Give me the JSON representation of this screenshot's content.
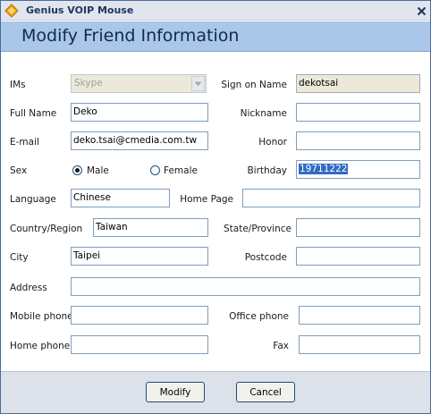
{
  "window": {
    "app_title": "Genius VOIP Mouse",
    "dialog_title": "Modify Friend Information"
  },
  "form": {
    "ims": {
      "label": "IMs",
      "value": "Skype"
    },
    "sign_on_name": {
      "label": "Sign on Name",
      "value": "dekotsai"
    },
    "full_name": {
      "label": "Full Name",
      "value": "Deko"
    },
    "nickname": {
      "label": "Nickname",
      "value": ""
    },
    "email": {
      "label": "E-mail",
      "value": "deko.tsai@cmedia.com.tw"
    },
    "honor": {
      "label": "Honor",
      "value": ""
    },
    "sex": {
      "label": "Sex",
      "options": [
        "Male",
        "Female"
      ],
      "selected": "Male"
    },
    "birthday": {
      "label": "Birthday",
      "value": "19711222"
    },
    "language": {
      "label": "Language",
      "value": "Chinese"
    },
    "home_page": {
      "label": "Home Page",
      "value": ""
    },
    "country": {
      "label": "Country/Region",
      "value": "Taiwan"
    },
    "state": {
      "label": "State/Province",
      "value": ""
    },
    "city": {
      "label": "City",
      "value": "Taipei"
    },
    "postcode": {
      "label": "Postcode",
      "value": ""
    },
    "address": {
      "label": "Address",
      "value": ""
    },
    "mobile_phone": {
      "label": "Mobile phone",
      "value": ""
    },
    "office_phone": {
      "label": "Office phone",
      "value": ""
    },
    "home_phone": {
      "label": "Home phone",
      "value": ""
    },
    "fax": {
      "label": "Fax",
      "value": ""
    }
  },
  "buttons": {
    "modify": "Modify",
    "cancel": "Cancel"
  },
  "icons": {
    "app": "genius-logo-icon",
    "close": "close-icon",
    "combo": "chevron-down-icon"
  },
  "colors": {
    "header_band": "#aac7e9",
    "header_text": "#0f2a4f",
    "selection": "#316ac5",
    "footer": "#dde2ea"
  }
}
